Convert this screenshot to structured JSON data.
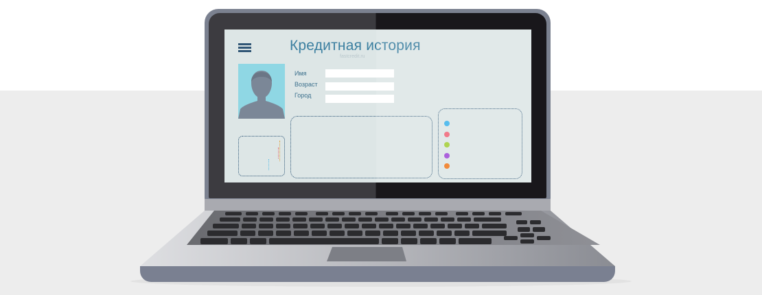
{
  "screen": {
    "title": "Кредитная история",
    "watermark": "fastcredit.ru",
    "fields": [
      {
        "label": "Имя"
      },
      {
        "label": "Возраст"
      },
      {
        "label": "Город"
      }
    ],
    "legend_colors": [
      "#3fb4ec",
      "#f0687a",
      "#a4cf3a",
      "#a14cd8",
      "#f07a20"
    ]
  },
  "icons": {
    "menu": "hamburger-menu-icon",
    "avatar": "person-silhouette-icon"
  }
}
